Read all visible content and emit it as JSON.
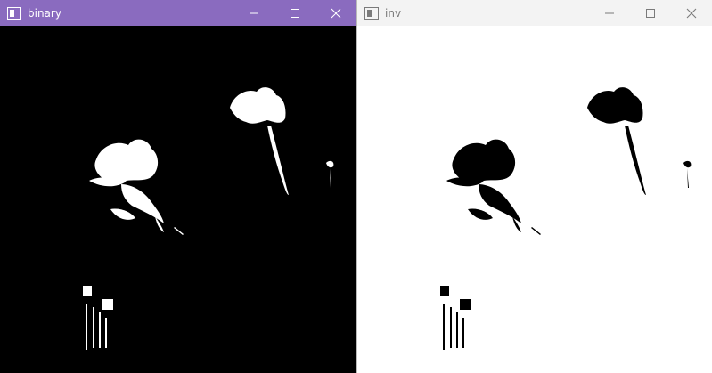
{
  "windows": [
    {
      "title": "binary",
      "controls": [
        "minimize-icon",
        "maximize-icon",
        "close-icon"
      ],
      "image": {
        "background": "#000000",
        "foreground": "#ffffff"
      }
    },
    {
      "title": "inv",
      "controls": [
        "minimize-icon",
        "maximize-icon",
        "close-icon"
      ],
      "image": {
        "background": "#ffffff",
        "foreground": "#000000"
      }
    }
  ],
  "colors": {
    "active_titlebar": "#8a6bbf",
    "inactive_titlebar": "#f3f3f3"
  }
}
